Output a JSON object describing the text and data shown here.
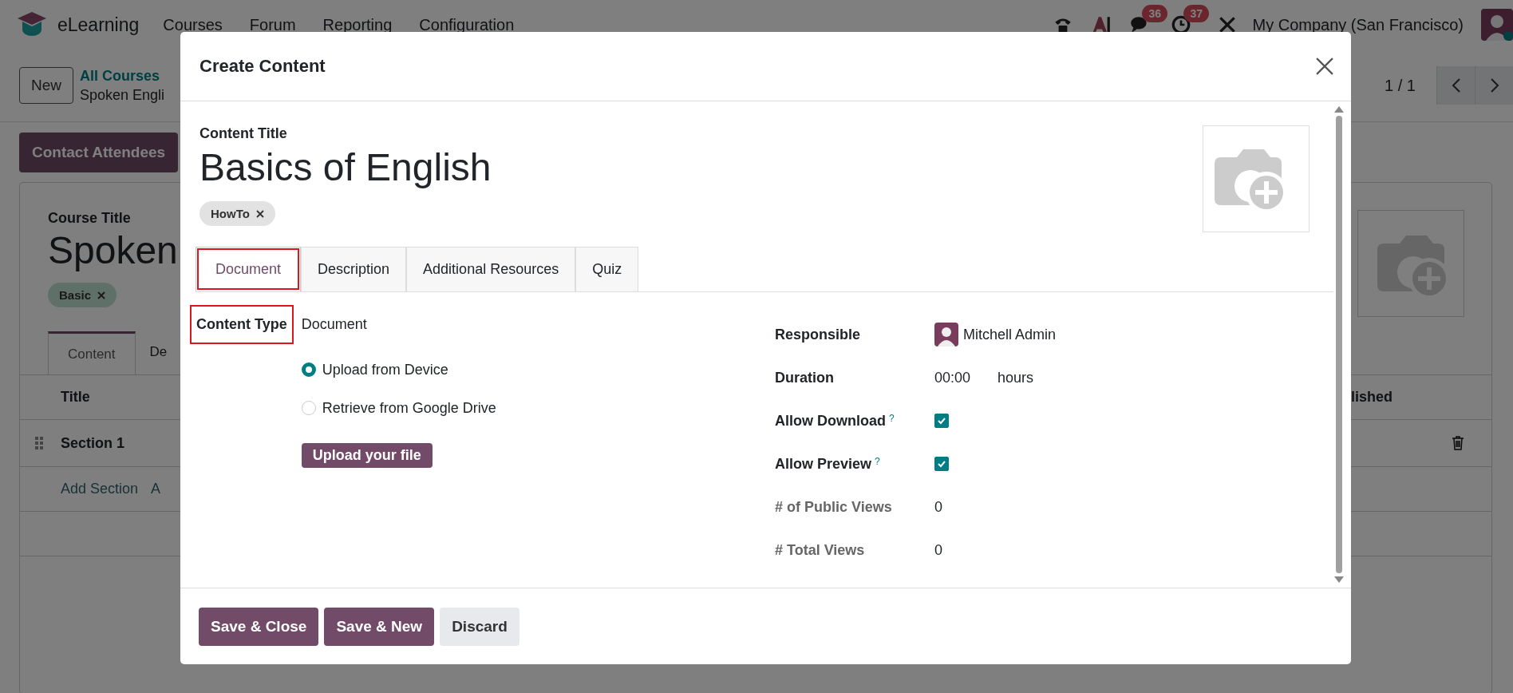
{
  "navbar": {
    "app_name": "eLearning",
    "menu": [
      "Courses",
      "Forum",
      "Reporting",
      "Configuration"
    ],
    "badges": [
      {
        "kind": "chat",
        "count": "36"
      },
      {
        "kind": "activity",
        "count": "37"
      }
    ],
    "company": "My Company (San Francisco)"
  },
  "control_panel": {
    "new_button": "New",
    "breadcrumb": "All Courses",
    "record_name": "Spoken Engli",
    "pager": "1 / 1"
  },
  "action_button": "Contact Attendees",
  "course_form": {
    "title_label": "Course Title",
    "title": "Spoken",
    "tags": [
      "Basic"
    ],
    "tabs": [
      {
        "label": "Content",
        "selected": true
      },
      {
        "label": "De",
        "selected": false
      }
    ],
    "table": {
      "columns": [
        "Title",
        "lished"
      ],
      "rows": [
        {
          "title": "Section 1"
        }
      ],
      "add_links": [
        "Add Section",
        "A"
      ]
    }
  },
  "dialog": {
    "title": "Create Content",
    "content_title_label": "Content Title",
    "content_title": "Basics of English",
    "tags": [
      "HowTo"
    ],
    "tabs": [
      {
        "label": "Document",
        "selected": true,
        "highlighted": true
      },
      {
        "label": "Description",
        "selected": false,
        "highlighted": false
      },
      {
        "label": "Additional Resources",
        "selected": false,
        "highlighted": false
      },
      {
        "label": "Quiz",
        "selected": false,
        "highlighted": false
      }
    ],
    "content_type": {
      "label": "Content Type",
      "value": "Document",
      "highlighted": true
    },
    "sources": [
      {
        "label": "Upload from Device",
        "selected": true
      },
      {
        "label": "Retrieve from Google Drive",
        "selected": false
      }
    ],
    "upload_button": "Upload your file",
    "fields": [
      {
        "kind": "user",
        "label": "Responsible",
        "value": "Mitchell Admin"
      },
      {
        "kind": "duration",
        "label": "Duration",
        "value": "00:00",
        "unit": "hours"
      },
      {
        "kind": "checkbox",
        "label": "Allow Download",
        "help": "?",
        "checked": true
      },
      {
        "kind": "checkbox",
        "label": "Allow Preview",
        "help": "?",
        "checked": true
      },
      {
        "kind": "stat",
        "label": "# of Public Views",
        "value": "0"
      },
      {
        "kind": "stat",
        "label": "# Total Views",
        "value": "0"
      }
    ],
    "buttons": [
      {
        "label": "Save & Close",
        "kind": "primary"
      },
      {
        "label": "Save & New",
        "kind": "primary"
      },
      {
        "label": "Discard",
        "kind": "secondary"
      }
    ]
  }
}
